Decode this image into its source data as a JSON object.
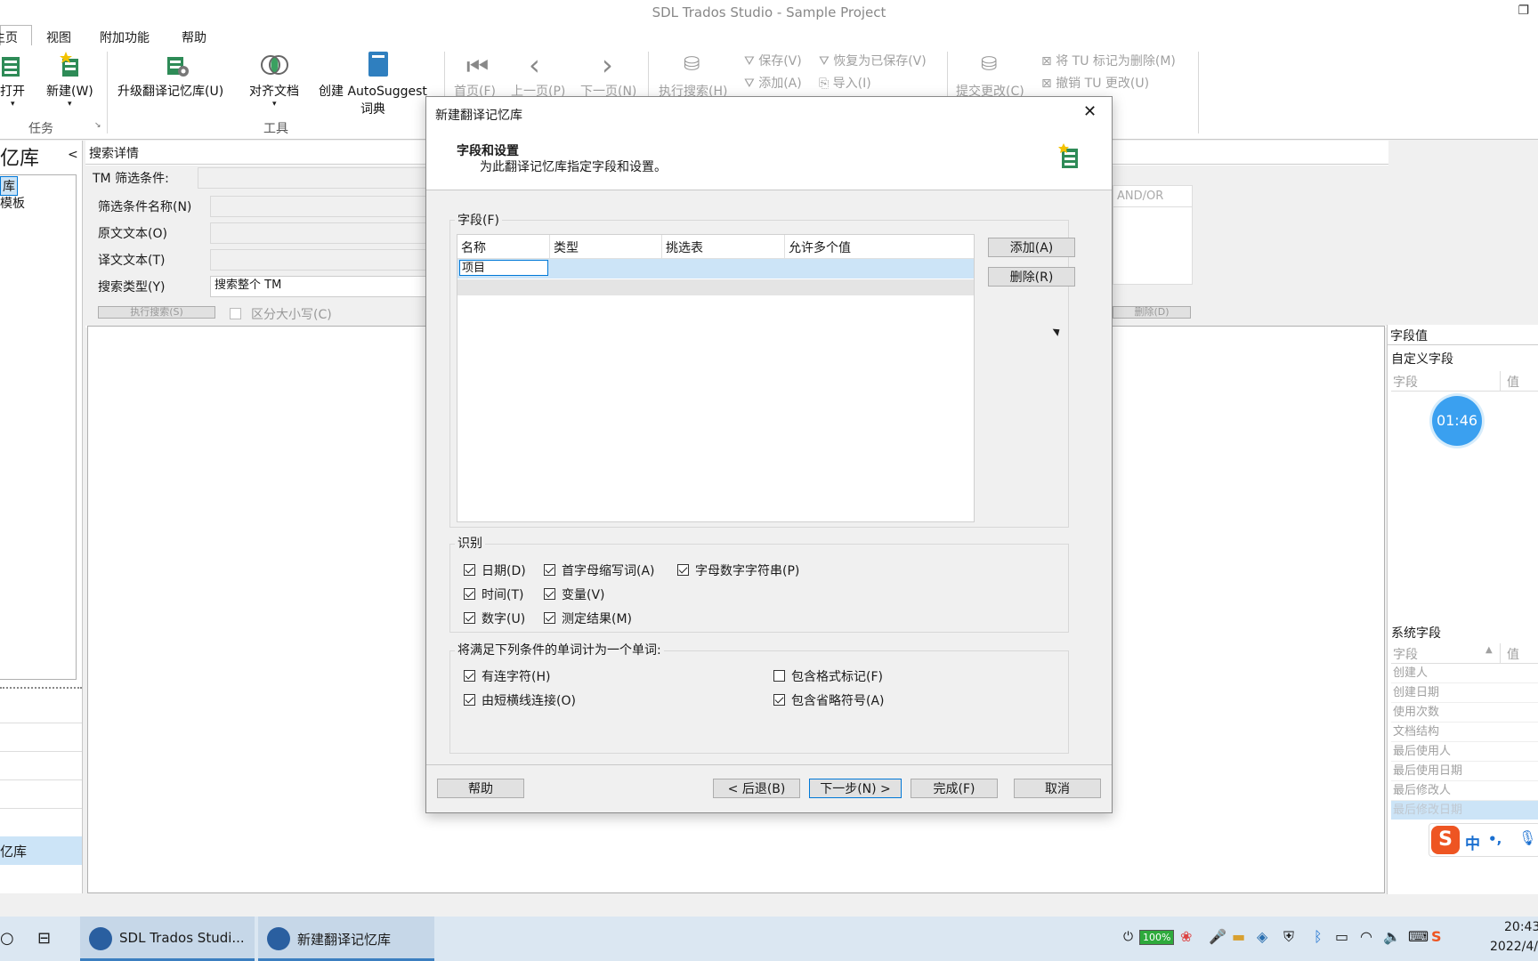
{
  "window": {
    "title": "SDL Trados Studio - Sample Project",
    "restore_glyph": "❐"
  },
  "menu": {
    "items": [
      "主页",
      "视图",
      "附加功能",
      "帮助"
    ]
  },
  "ribbon": {
    "task_group": {
      "open": "打开",
      "new": "新建(W)",
      "label": "任务"
    },
    "tools": {
      "upgrade": "升级翻译记忆库(U)",
      "align": "对齐文档",
      "create_as": "创建 AutoSuggest",
      "create_as2": "词典",
      "label": "工具"
    },
    "nav": {
      "first": "首页(F)",
      "prev": "上一页(P)",
      "next": "下一页(N)",
      "exec_search": "执行搜索(H)"
    },
    "filters": {
      "save": "保存(V)",
      "restore": "恢复为已保存(V)",
      "add": "添加(A)",
      "import": "导入(I)"
    },
    "tu": {
      "commit": "提交更改(C)",
      "mark_delete": "将 TU 标记为删除(M)",
      "undo": "撤销 TU 更改(U)"
    }
  },
  "left_panel": {
    "title": "亿库",
    "items": [
      "库",
      "模板"
    ],
    "bottom_item": "亿库",
    "collapse_glyph": "<"
  },
  "search": {
    "header": "搜索详情",
    "tm_filter_label": "TM 筛选条件:",
    "filter_name_label": "筛选条件名称(N)",
    "source_label": "原文文本(O)",
    "target_label": "译文文本(T)",
    "type_label": "搜索类型(Y)",
    "type_value": "搜索整个 TM",
    "case_label": "区分大小写(C)",
    "exec_button": "执行搜索(S)",
    "andor": "AND/OR",
    "delete_button": "删除(D)"
  },
  "right_panel": {
    "title": "字段值",
    "custom_fields": "自定义字段",
    "col_field": "字段",
    "col_value": "值",
    "timer": "01:46",
    "system_fields": "系统字段",
    "sys_items": [
      "创建人",
      "创建日期",
      "使用次数",
      "文档结构",
      "最后使用人",
      "最后使用日期",
      "最后修改人",
      "最后修改日期"
    ],
    "ime": {
      "lang": "中",
      "punct": "•,"
    }
  },
  "dialog": {
    "title": "新建翻译记忆库",
    "heading": "字段和设置",
    "subheading": "为此翻译记忆库指定字段和设置。",
    "fields_legend": "字段(F)",
    "columns": [
      "名称",
      "类型",
      "挑选表",
      "允许多个值"
    ],
    "editing_value": "项目",
    "add_button": "添加(A)",
    "delete_button": "删除(R)",
    "recognize_legend": "识别",
    "recognize": [
      {
        "label": "日期(D)",
        "checked": true
      },
      {
        "label": "首字母缩写词(A)",
        "checked": true
      },
      {
        "label": "字母数字字符串(P)",
        "checked": true
      },
      {
        "label": "时间(T)",
        "checked": true
      },
      {
        "label": "变量(V)",
        "checked": true
      },
      {
        "label": "数字(U)",
        "checked": true
      },
      {
        "label": "测定结果(M)",
        "checked": true
      }
    ],
    "word_legend": "将满足下列条件的单词计为一个单词:",
    "word_options": [
      {
        "label": "有连字符(H)",
        "checked": true
      },
      {
        "label": "包含格式标记(F)",
        "checked": false
      },
      {
        "label": "由短横线连接(O)",
        "checked": true
      },
      {
        "label": "包含省略符号(A)",
        "checked": true
      }
    ],
    "buttons": {
      "help": "帮助",
      "back": "< 后退(B)",
      "next": "下一步(N) >",
      "finish": "完成(F)",
      "cancel": "取消"
    },
    "close_glyph": "✕"
  },
  "taskbar": {
    "app1": "SDL Trados Studi...",
    "app2": "新建翻译记忆库",
    "battery": "100%",
    "time": "20:43",
    "date": "2022/4/"
  },
  "colors": {
    "accent": "#0078d7",
    "selection": "#cce4f7",
    "taskbar": "#dbe7f2",
    "timer": "#3aa0f0"
  }
}
